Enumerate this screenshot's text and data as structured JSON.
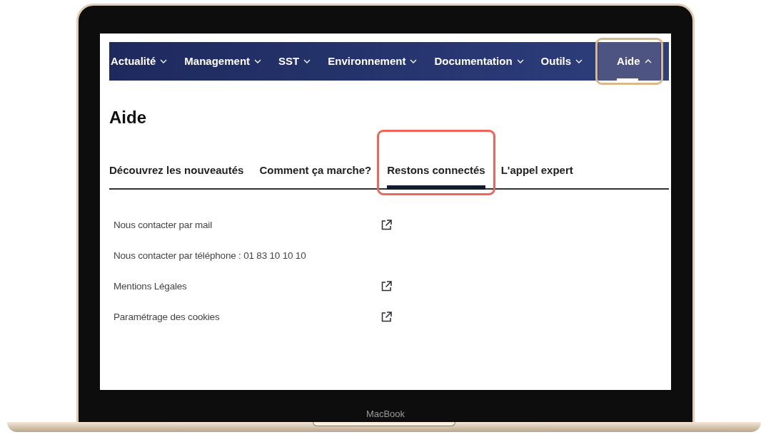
{
  "device": {
    "label": "MacBook"
  },
  "menu": [
    {
      "label": "Actualité",
      "selected": false,
      "expanded": false
    },
    {
      "label": "Management",
      "selected": false,
      "expanded": false
    },
    {
      "label": "SST",
      "selected": false,
      "expanded": false
    },
    {
      "label": "Environnement",
      "selected": false,
      "expanded": false
    },
    {
      "label": "Documentation",
      "selected": false,
      "expanded": false
    },
    {
      "label": "Outils",
      "selected": false,
      "expanded": false
    },
    {
      "label": "Aide",
      "selected": true,
      "expanded": true,
      "color": "#d9b98a"
    }
  ],
  "page_title": "Aide",
  "tabs": [
    {
      "label": "Découvrez les nouveautés",
      "selected": false
    },
    {
      "label": "Comment ça marche?",
      "selected": false
    },
    {
      "label": "Restons connectés",
      "selected": true,
      "color": "#f0645a"
    },
    {
      "label": "L'appel expert",
      "selected": false
    }
  ],
  "links": [
    {
      "label": "Nous contacter par mail",
      "external": true
    },
    {
      "label": "Nous contacter par téléphone : 01 83 10 10 10",
      "external": false
    },
    {
      "label": "Mentions Légales",
      "external": true
    },
    {
      "label": "Paramétrage des cookies",
      "external": true
    }
  ]
}
